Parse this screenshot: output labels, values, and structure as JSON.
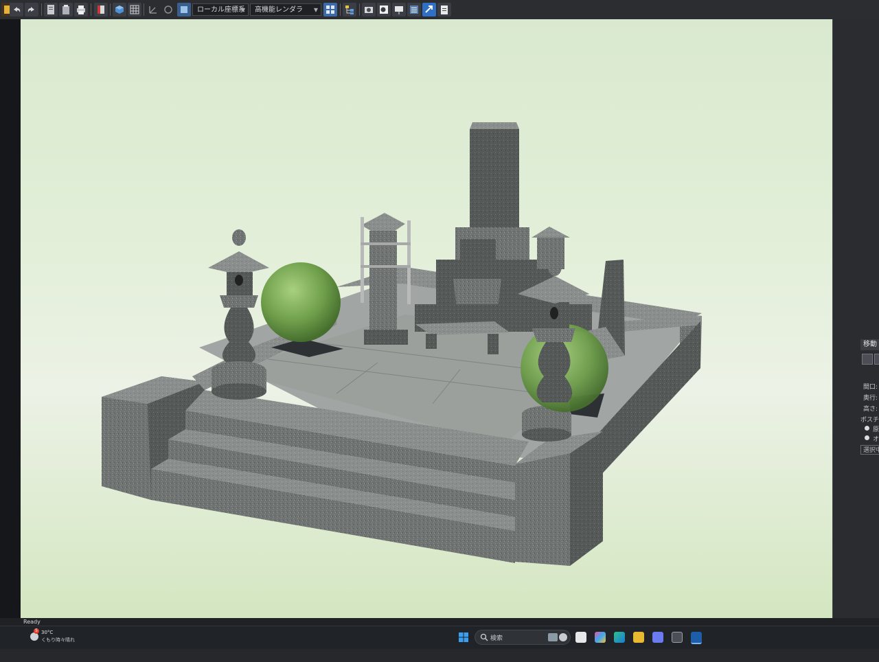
{
  "toolbar": {
    "coordinate_system": "ローカル座標系",
    "renderer": "高機能レンダラ"
  },
  "side_panel": {
    "header": "移動・",
    "fields": [
      "間口:",
      "奥行:",
      "高さ:"
    ],
    "position_label": "ポスチ",
    "options": [
      "原",
      "オブ"
    ],
    "selected_button": "選択中"
  },
  "status": {
    "text": "Ready"
  },
  "taskbar": {
    "weather_badge": "5",
    "temperature": "30°C",
    "weather_desc": "くもり時々晴れ",
    "search_placeholder": "検索"
  },
  "colors": {
    "toolbar": "#2b2d31",
    "viewport_top": "#d9e9cf",
    "viewport_bottom": "#d3e6c0",
    "granite": "#6d7170",
    "granite_dark": "#515554",
    "shrub": "#7fae5a",
    "taskbar": "#202328"
  }
}
